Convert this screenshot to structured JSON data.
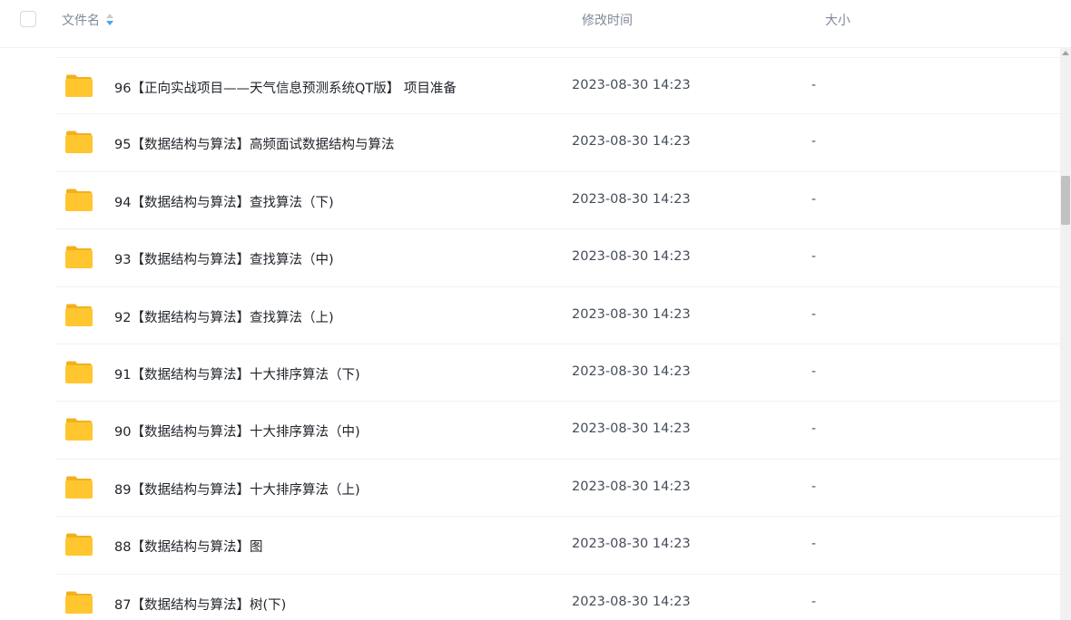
{
  "header": {
    "name_label": "文件名",
    "time_label": "修改时间",
    "size_label": "大小",
    "sort_active_color": "#4aa3f3"
  },
  "folder_color": "#ffc62f",
  "files": [
    {
      "name": "96【正向实战项目——天气信息预测系统QT版】 项目准备",
      "modified": "2023-08-30 14:23",
      "size": "-"
    },
    {
      "name": "95【数据结构与算法】高频面试数据结构与算法",
      "modified": "2023-08-30 14:23",
      "size": "-"
    },
    {
      "name": "94【数据结构与算法】查找算法（下)",
      "modified": "2023-08-30 14:23",
      "size": "-"
    },
    {
      "name": "93【数据结构与算法】查找算法（中)",
      "modified": "2023-08-30 14:23",
      "size": "-"
    },
    {
      "name": "92【数据结构与算法】查找算法（上)",
      "modified": "2023-08-30 14:23",
      "size": "-"
    },
    {
      "name": "91【数据结构与算法】十大排序算法（下)",
      "modified": "2023-08-30 14:23",
      "size": "-"
    },
    {
      "name": "90【数据结构与算法】十大排序算法（中)",
      "modified": "2023-08-30 14:23",
      "size": "-"
    },
    {
      "name": "89【数据结构与算法】十大排序算法（上)",
      "modified": "2023-08-30 14:23",
      "size": "-"
    },
    {
      "name": "88【数据结构与算法】图",
      "modified": "2023-08-30 14:23",
      "size": "-"
    },
    {
      "name": "87【数据结构与算法】树(下)",
      "modified": "2023-08-30 14:23",
      "size": "-"
    }
  ]
}
